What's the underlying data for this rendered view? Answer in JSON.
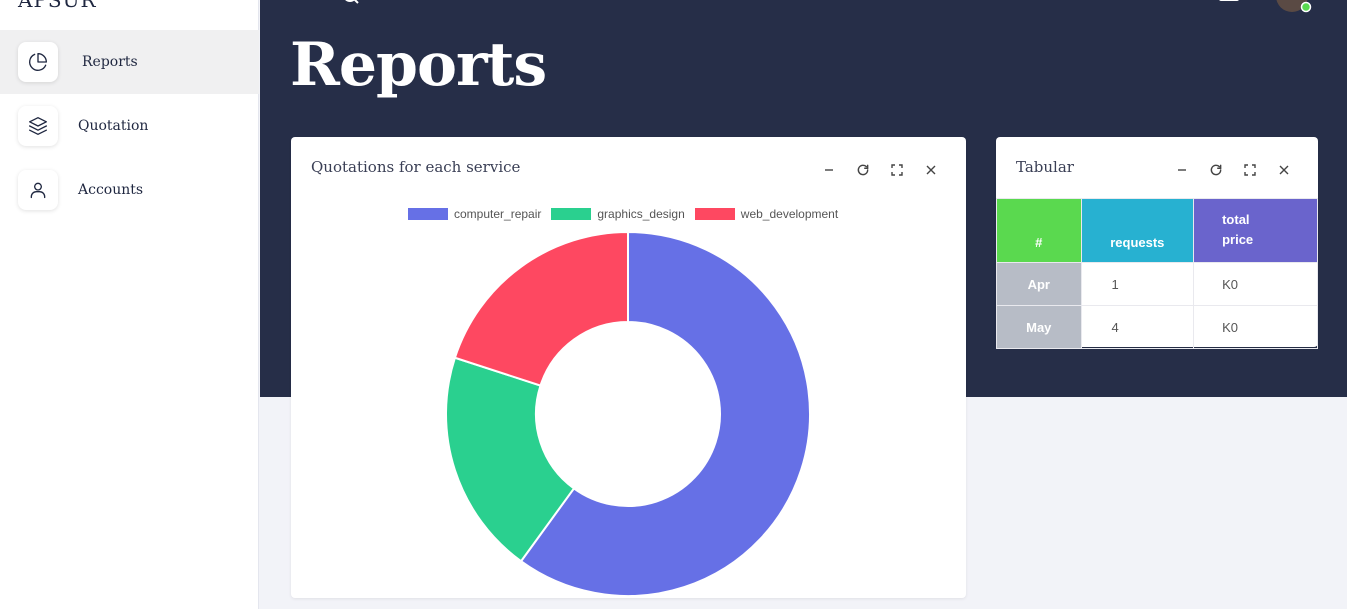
{
  "brand": "APSUR",
  "sidebar": {
    "items": [
      {
        "label": "Reports",
        "icon": "pie-chart-icon"
      },
      {
        "label": "Quotation",
        "icon": "layers-icon"
      },
      {
        "label": "Accounts",
        "icon": "user-icon"
      }
    ]
  },
  "header": {
    "title": "Reports"
  },
  "chart_card": {
    "title": "Quotations for each service"
  },
  "chart_data": {
    "type": "pie",
    "variant": "doughnut",
    "categories": [
      "computer_repair",
      "graphics_design",
      "web_development"
    ],
    "values": [
      3,
      1,
      1
    ],
    "colors": [
      "#6670e6",
      "#2ad08f",
      "#fe4861"
    ],
    "title": "",
    "legend": "top"
  },
  "table_card": {
    "title": "Tabular",
    "columns": [
      "#",
      "requests",
      "total price"
    ],
    "column_colors": [
      "#5ad94f",
      "#27b1d1",
      "#6a64cc"
    ],
    "rows": [
      {
        "label": "Apr",
        "requests": "1",
        "total_price": "K0"
      },
      {
        "label": "May",
        "requests": "4",
        "total_price": "K0"
      }
    ]
  }
}
